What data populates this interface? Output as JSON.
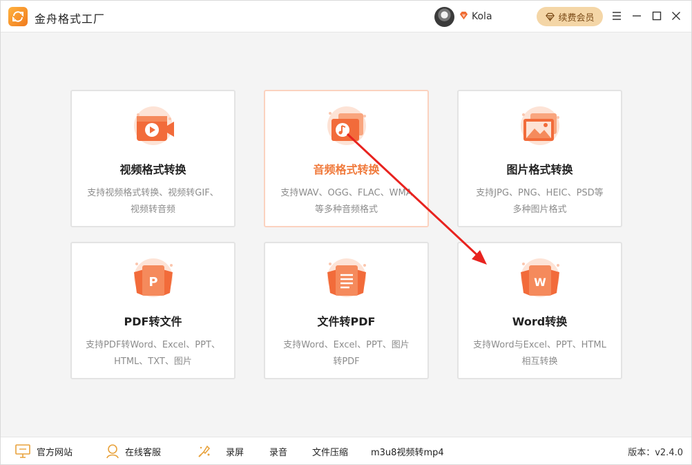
{
  "app": {
    "title": "金舟格式工厂",
    "username": "Kola",
    "renew_label": "续费会员"
  },
  "colors": {
    "accent": "#f07a3c",
    "icon_orange": "#f26b3a",
    "annotation_arrow": "#e8231f",
    "card_border_active": "#fbd2bf"
  },
  "cards": [
    {
      "title": "视频格式转换",
      "desc_line1": "支持视频格式转换、视频转GIF、",
      "desc_line2": "视频转音频",
      "icon": "video-camera-icon"
    },
    {
      "title": "音频格式转换",
      "desc_line1": "支持WAV、OGG、FLAC、WMA",
      "desc_line2": "等多种音频格式",
      "icon": "music-note-icon"
    },
    {
      "title": "图片格式转换",
      "desc_line1": "支持JPG、PNG、HEIC、PSD等",
      "desc_line2": "多种图片格式",
      "icon": "image-icon"
    },
    {
      "title": "PDF转文件",
      "desc_line1": "支持PDF转Word、Excel、PPT、",
      "desc_line2": "HTML、TXT、图片",
      "icon": "pdf-p-icon"
    },
    {
      "title": "文件转PDF",
      "desc_line1": "支持Word、Excel、PPT、图片",
      "desc_line2": "转PDF",
      "icon": "document-icon"
    },
    {
      "title": "Word转换",
      "desc_line1": "支持Word与Excel、PPT、HTML",
      "desc_line2": "相互转换",
      "icon": "word-w-icon"
    }
  ],
  "card_glyphs": {
    "pdf_letter": "P",
    "word_letter": "W"
  },
  "bottombar": {
    "site": "官方网站",
    "service": "在线客服",
    "record_screen": "录屏",
    "record_audio": "录音",
    "compress": "文件压缩",
    "m3u8": "m3u8视频转mp4",
    "version": "版本：v2.4.0"
  }
}
